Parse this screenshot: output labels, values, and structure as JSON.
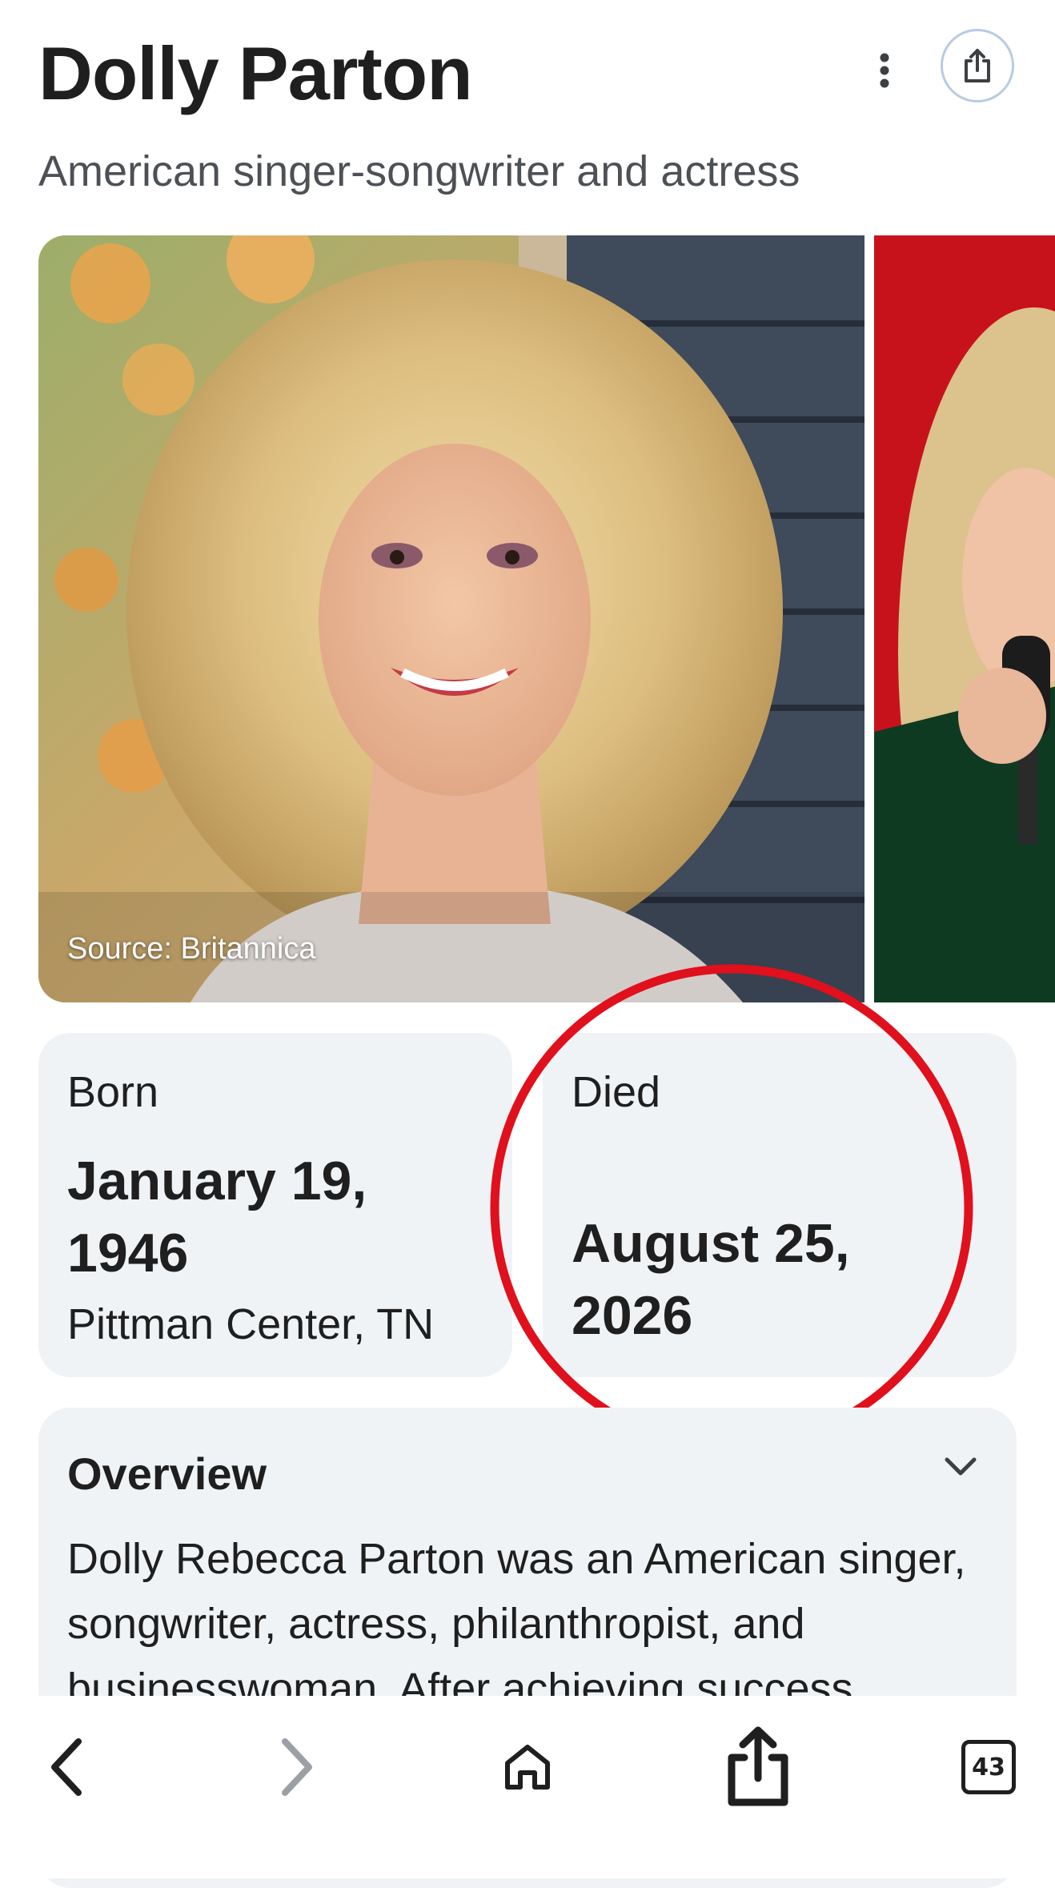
{
  "header": {
    "title": "Dolly Parton",
    "subtitle": "American singer-songwriter and actress",
    "more_icon": "more-vert-icon",
    "share_icon": "share-icon"
  },
  "images": {
    "source_label": "Source: Britannica"
  },
  "born": {
    "label": "Born",
    "date_line1": "January 19,",
    "date_line2": "1946",
    "place": "Pittman Center, TN"
  },
  "died": {
    "label": "Died",
    "date_line1": "August 25,",
    "date_line2": "2026"
  },
  "overview": {
    "title": "Overview",
    "text": "Dolly Rebecca Parton was an American singer, songwriter, actress, philanthropist, and businesswoman. After achieving success"
  },
  "bottom_nav": {
    "tab_count": "43"
  },
  "colors": {
    "card_bg": "#eff3f6",
    "circle_red": "#e0101c",
    "share_ring": "#b7cbe2",
    "disabled_gray": "#9aa0a6"
  }
}
